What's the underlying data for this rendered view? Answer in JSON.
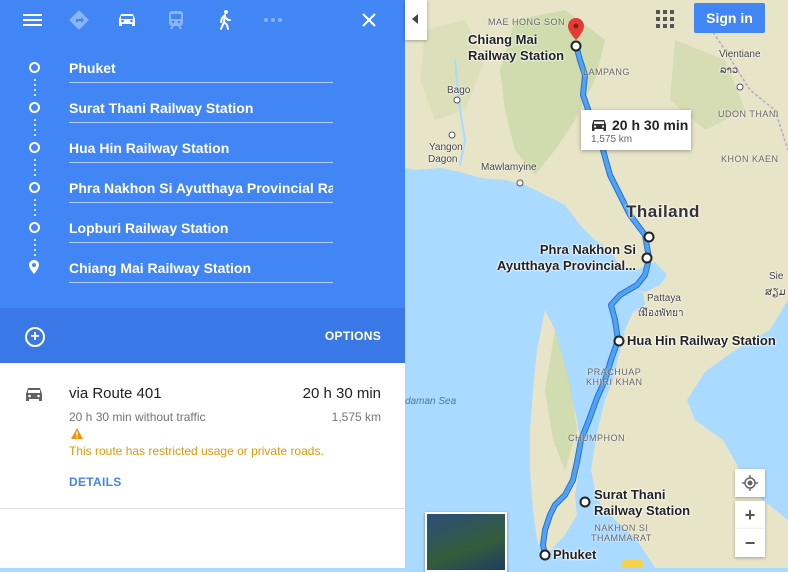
{
  "header": {
    "modes": [
      "menu-icon",
      "best-mode-icon",
      "car-icon",
      "transit-icon",
      "walk-icon",
      "more-icon",
      "close-icon"
    ]
  },
  "stops": [
    {
      "label": "Phuket"
    },
    {
      "label": "Surat Thani Railway Station"
    },
    {
      "label": "Hua Hin Railway Station"
    },
    {
      "label": "Phra Nakhon Si Ayutthaya Provincial Railway Station"
    },
    {
      "label": "Lopburi Railway Station"
    },
    {
      "label": "Chiang Mai Railway Station"
    }
  ],
  "options_label": "OPTIONS",
  "route": {
    "name": "via Route 401",
    "duration": "20 h 30 min",
    "traffic_note": "20 h 30 min without traffic",
    "distance": "1,575 km",
    "warning": "This route has restricted usage or private roads.",
    "details_label": "DETAILS"
  },
  "map": {
    "signin_label": "Sign in",
    "callout_time": "20 h 30 min",
    "callout_distance": "1,575 km",
    "country_label": "Thailand",
    "sea_label": "daman Sea",
    "place_labels": {
      "chiang_mai": [
        "Chiang Mai",
        "Railway Station"
      ],
      "ayutthaya": [
        "Phra Nakhon Si",
        "Ayutthaya Provincial..."
      ],
      "hua_hin": "Hua Hin Railway Station",
      "surat_thani": [
        "Surat Thani",
        "Railway Station"
      ],
      "phuket": "Phuket"
    },
    "towns": {
      "bago": "Bago",
      "yangon": "Yangon",
      "mawlamyine": "Mawlamyine",
      "vientiane": "Vientiane",
      "pattaya": "Pattaya",
      "pattaya_thai": "เมืองพัทยา",
      "lao": "ລາວ",
      "sie": "Sie",
      "khmer": "ສຽມ",
      "dagon": "Dagon"
    },
    "regions": {
      "mae_hong_son": "MAE HONG SON",
      "lampang": "LAMPANG",
      "udon_thani": "UDON THANI",
      "khon_kaen": "KHON KAEN",
      "prachuap": [
        "PRACHUAP",
        "KHIRI KHAN"
      ],
      "chumphon": "CHUMPHON",
      "nakhon_si": [
        "NAKHON SI",
        "THAMMARAT"
      ]
    },
    "zoom_in": "+",
    "zoom_out": "−",
    "colors": {
      "route": "#4fa3f0",
      "route_outline": "#2a6fd6",
      "land": "#e8e4c8",
      "forest": "#c9d9a6",
      "water": "#aadaff",
      "accent": "#4285f4",
      "pin": "#e53935"
    }
  }
}
